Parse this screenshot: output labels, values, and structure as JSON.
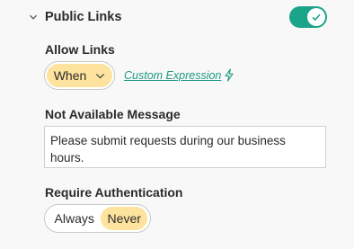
{
  "section": {
    "title": "Public Links",
    "enabled": true,
    "accent_color": "#1aa48a"
  },
  "allow_links": {
    "label": "Allow Links",
    "selected": "When",
    "custom_expression_label": "Custom Expression",
    "highlight_color": "#fde39e"
  },
  "not_available": {
    "label": "Not Available Message",
    "value": "Please submit requests during our business hours."
  },
  "require_auth": {
    "label": "Require Authentication",
    "options": [
      "Always",
      "Never"
    ],
    "selected": "Never"
  }
}
